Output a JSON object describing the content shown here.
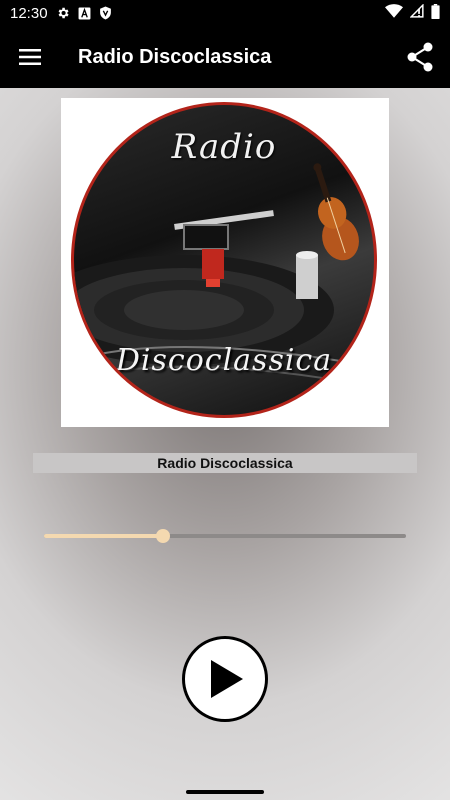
{
  "status_bar": {
    "time": "12:30",
    "left_icons": [
      "gear-icon",
      "a-box-icon",
      "shield-icon"
    ],
    "right_icons": [
      "wifi-icon",
      "signal-icon",
      "battery-icon"
    ]
  },
  "app_bar": {
    "title": "Radio Discoclassica",
    "menu_icon": "hamburger-menu-icon",
    "share_icon": "share-icon"
  },
  "cover": {
    "word1": "Radio",
    "word2": "Discoclassica",
    "ring_color": "#b3241a"
  },
  "player": {
    "station_name": "Radio Discoclassica",
    "volume_fraction": 0.33,
    "volume_color": "#f4d9b0",
    "play_icon": "play-icon"
  }
}
